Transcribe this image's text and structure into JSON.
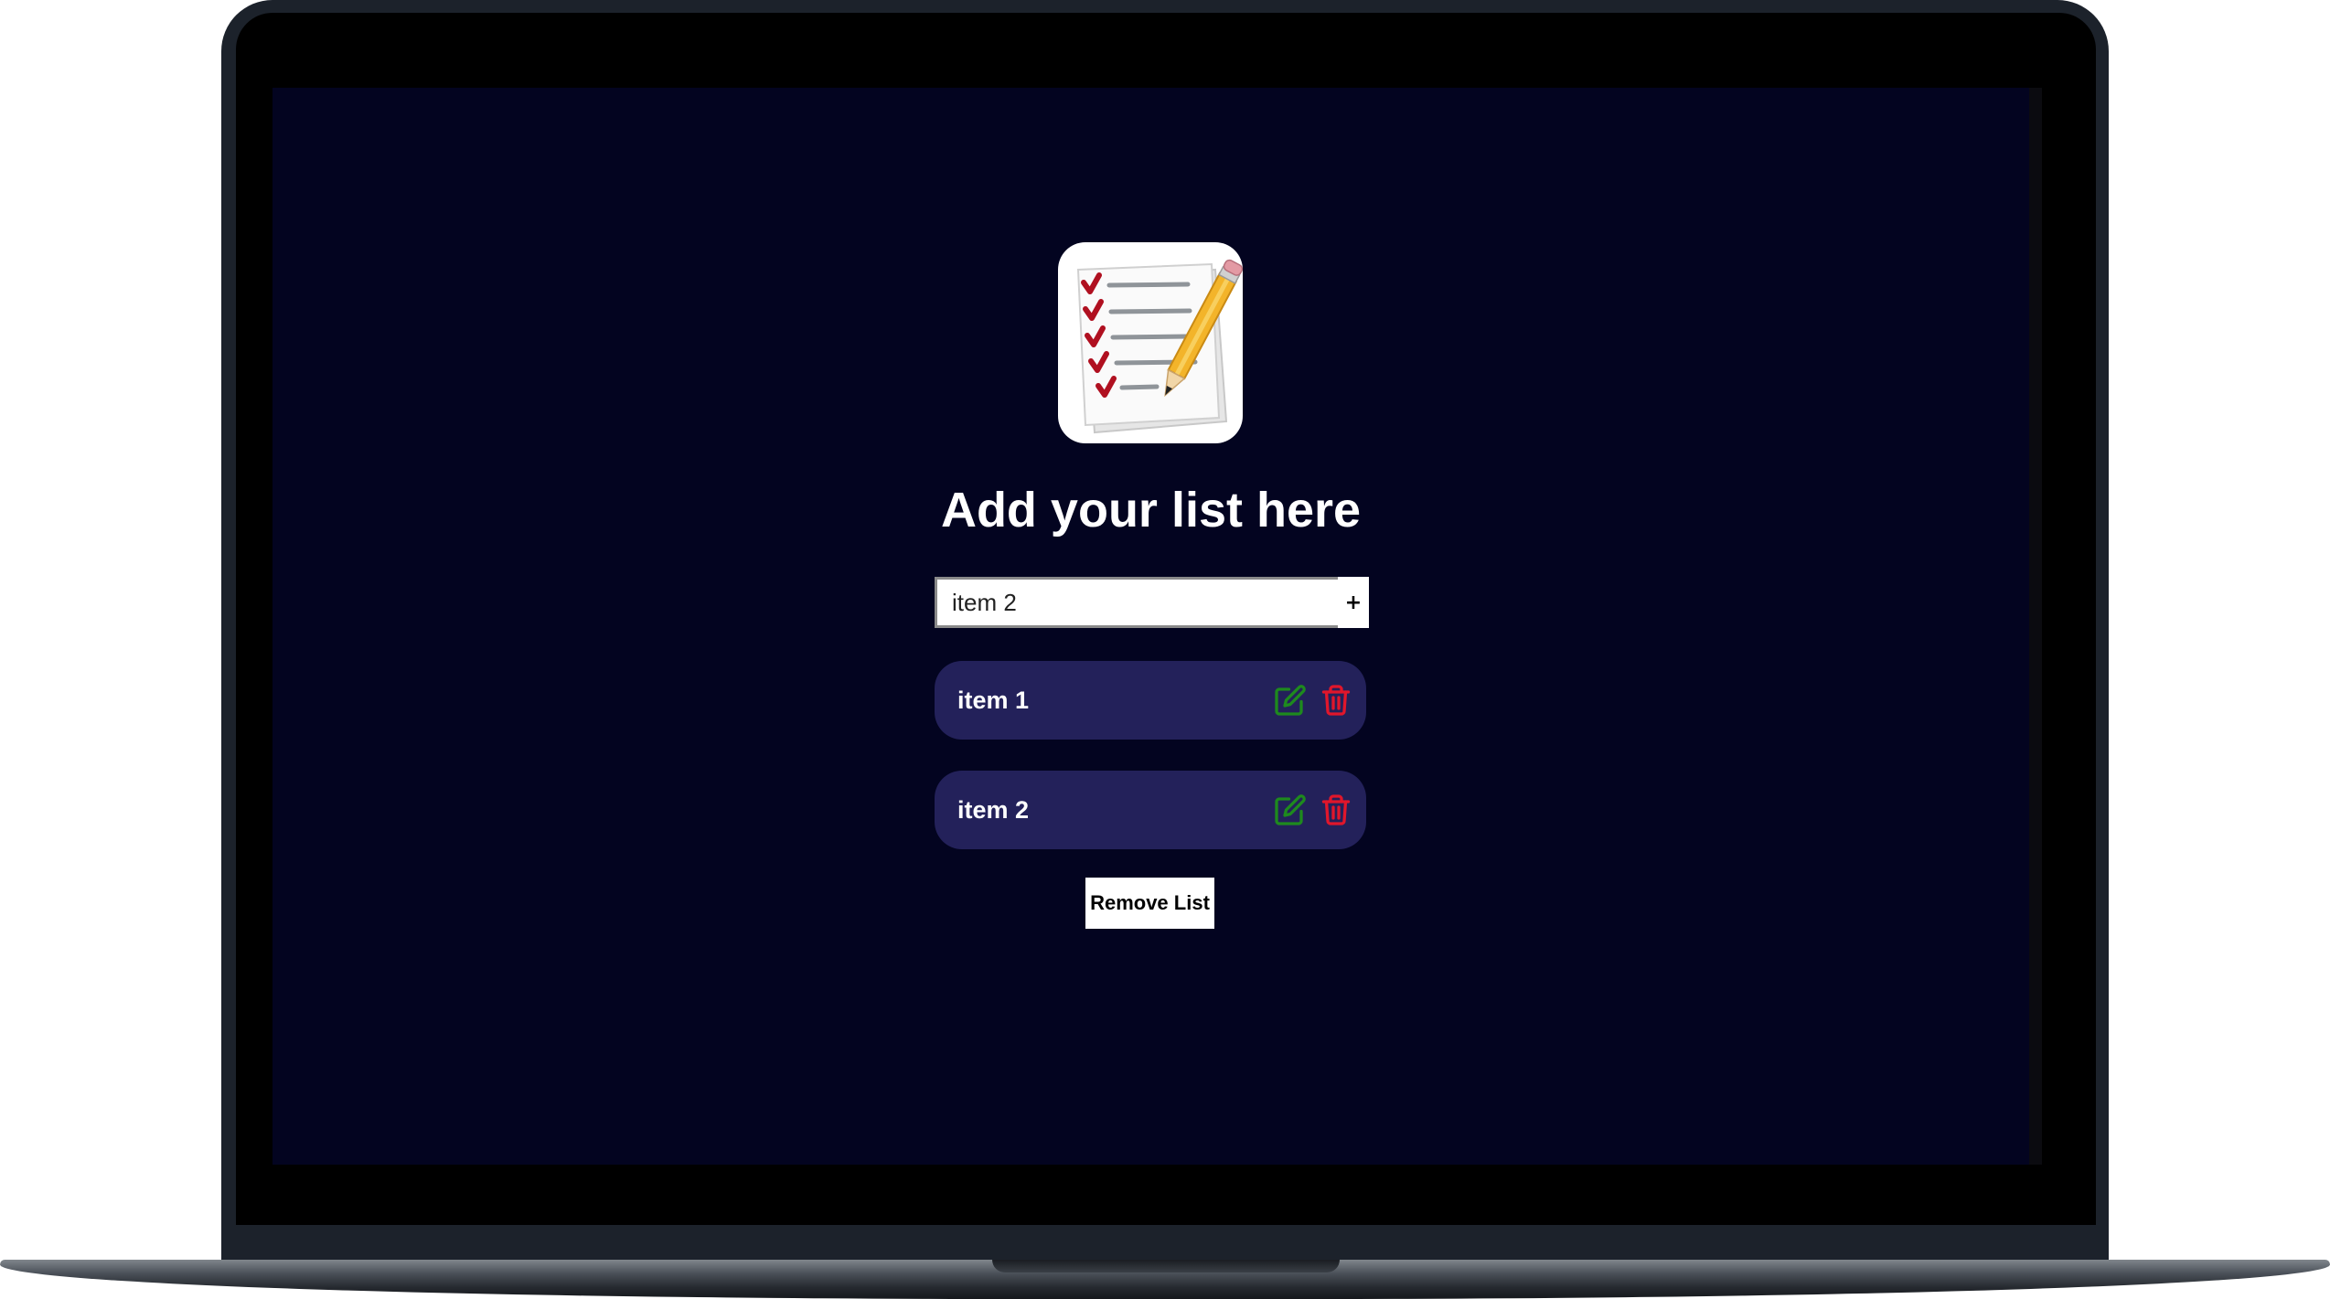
{
  "app": {
    "logo_icon": "checklist-pencil-icon",
    "title": "Add your list here"
  },
  "form": {
    "input_value": "item 2",
    "add_label": "+"
  },
  "items": [
    {
      "label": "item 1",
      "edit_icon": "edit-icon",
      "delete_icon": "trash-icon"
    },
    {
      "label": "item 2",
      "edit_icon": "edit-icon",
      "delete_icon": "trash-icon"
    }
  ],
  "remove_label": "Remove List",
  "colors": {
    "screen_bg": "#030420",
    "item_bg": "#23215a",
    "edit": "#1e8a1e",
    "delete": "#e0162b"
  }
}
